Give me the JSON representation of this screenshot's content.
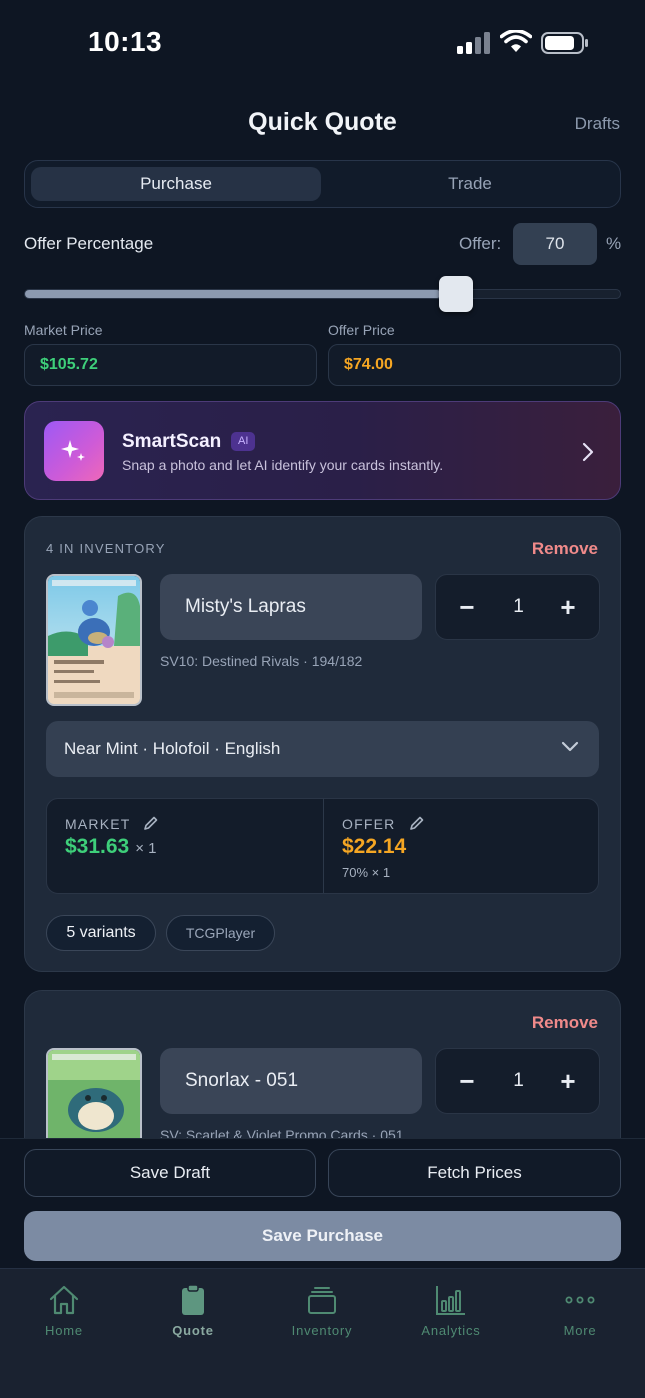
{
  "status_bar": {
    "time": "10:13"
  },
  "header": {
    "title": "Quick Quote",
    "drafts_label": "Drafts"
  },
  "segmented": {
    "options": [
      "Purchase",
      "Trade"
    ],
    "selected": "Purchase"
  },
  "offer": {
    "label": "Offer Percentage",
    "offer_label": "Offer:",
    "value": "70",
    "unit": "%",
    "slider_fraction": 0.7
  },
  "prices": {
    "market_label": "Market Price",
    "market_value": "$105.72",
    "offer_label": "Offer Price",
    "offer_value": "$74.00"
  },
  "smartscan": {
    "title": "SmartScan",
    "badge": "AI",
    "subtitle": "Snap a photo and let AI identify your cards instantly."
  },
  "items": [
    {
      "inventory_label": "4 IN INVENTORY",
      "remove_label": "Remove",
      "name": "Misty's Lapras",
      "quantity": "1",
      "set_line": "SV10: Destined Rivals · 194/182",
      "variant": "Near Mint · Holofoil · English",
      "market_label": "MARKET",
      "market_value": "$31.63",
      "market_mult": "× 1",
      "offer_label": "OFFER",
      "offer_value": "$22.14",
      "offer_sub": "70% × 1",
      "variants_chip": "5 variants",
      "source_chip": "TCGPlayer"
    },
    {
      "remove_label": "Remove",
      "name": "Snorlax - 051",
      "quantity": "1",
      "set_line": "SV: Scarlet & Violet Promo Cards · 051"
    }
  ],
  "actions": {
    "save_draft": "Save Draft",
    "fetch_prices": "Fetch Prices",
    "save_purchase": "Save Purchase"
  },
  "tabbar": {
    "tabs": [
      "Home",
      "Quote",
      "Inventory",
      "Analytics",
      "More"
    ],
    "active": "Quote"
  },
  "colors": {
    "green": "#3ecf7a",
    "orange": "#f5a623",
    "remove": "#f08a8a",
    "accent_purple": "#9d59f5"
  }
}
